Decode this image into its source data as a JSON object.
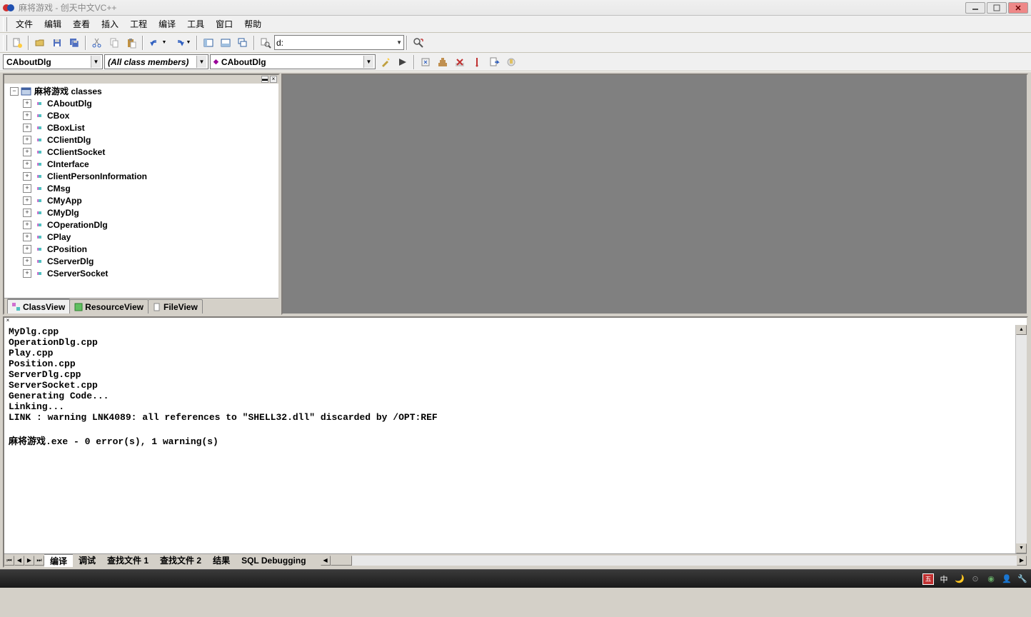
{
  "window": {
    "title": "麻将游戏 - 创天中文VC++"
  },
  "menu": {
    "items": [
      "文件",
      "编辑",
      "查看",
      "插入",
      "工程",
      "编译",
      "工具",
      "窗口",
      "帮助"
    ]
  },
  "toolbar1": {
    "path_combo": "d:"
  },
  "toolbar2": {
    "class_combo": "CAboutDlg",
    "filter_combo": "(All class members)",
    "member_combo": "CAboutDlg"
  },
  "workspace": {
    "root": "麻将游戏 classes",
    "classes": [
      "CAboutDlg",
      "CBox",
      "CBoxList",
      "CClientDlg",
      "CClientSocket",
      "CInterface",
      "ClientPersonInformation",
      "CMsg",
      "CMyApp",
      "CMyDlg",
      "COperationDlg",
      "CPlay",
      "CPosition",
      "CServerDlg",
      "CServerSocket"
    ],
    "tabs": [
      "ClassView",
      "ResourceView",
      "FileView"
    ]
  },
  "output": {
    "lines": [
      "MyDlg.cpp",
      "OperationDlg.cpp",
      "Play.cpp",
      "Position.cpp",
      "ServerDlg.cpp",
      "ServerSocket.cpp",
      "Generating Code...",
      "Linking...",
      "LINK : warning LNK4089: all references to \"SHELL32.dll\" discarded by /OPT:REF",
      "",
      "麻将游戏.exe - 0 error(s), 1 warning(s)"
    ],
    "tabs": [
      "编译",
      "调试",
      "查找文件 1",
      "查找文件 2",
      "结果",
      "SQL Debugging"
    ]
  },
  "tray": {
    "ime": "中"
  }
}
